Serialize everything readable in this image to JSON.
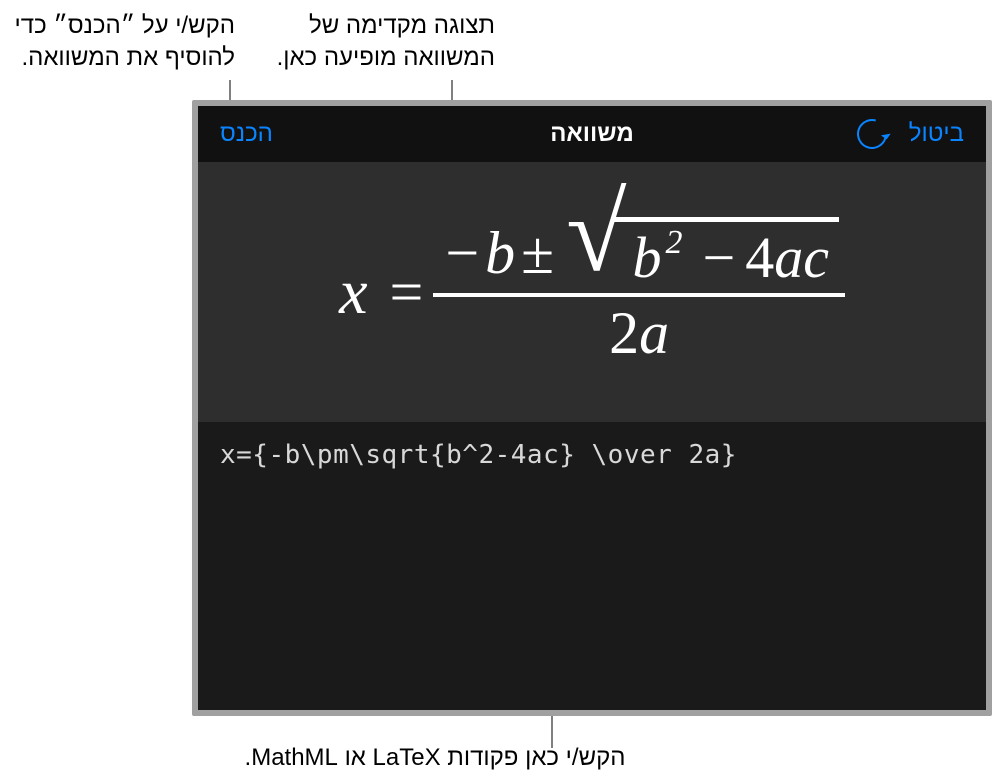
{
  "callouts": {
    "preview": "תצוגה מקדימה של המשוואה מופיעה כאן.",
    "insert": "הקש/י על ״הכנס״ כדי להוסיף את המשוואה.",
    "input": "הקש/י כאן פקודות LaTeX או MathML."
  },
  "toolbar": {
    "cancel": "ביטול",
    "title": "משוואה",
    "insert": "הכנס"
  },
  "code": "x={-b\\pm\\sqrt{b^2-4ac} \\over 2a}",
  "eq": {
    "x": "x",
    "b": "b",
    "b2": "b",
    "two": "2",
    "minus": "−",
    "pm": "±",
    "four": "4",
    "a": "a",
    "c": "c",
    "a2": "a",
    "two2": "2",
    "equals": "="
  }
}
